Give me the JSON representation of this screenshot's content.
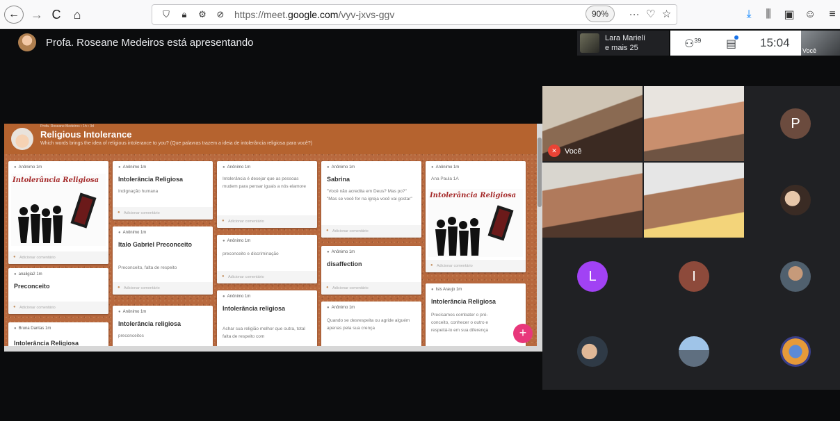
{
  "browser": {
    "back_icon": "←",
    "forward_icon": "→",
    "reload_icon": "C",
    "home_icon": "⌂",
    "url_prefix": "https://meet.",
    "url_host": "google.com",
    "url_path": "/vyv-jxvs-ggv",
    "zoom": "90%",
    "more_icon": "···"
  },
  "meet": {
    "presenting_text": "Profa. Roseane Medeiros está apresentando",
    "pinned_name": "Lara Marielí",
    "pinned_more": "e mais 25",
    "participant_count": "39",
    "clock": "15:04",
    "self_label": "Você"
  },
  "padlet": {
    "byline": "Profa. Roseane Medeiros • 1h • 3d",
    "title": "Religious Intolerance",
    "subtitle": "Which words brings the idea of religious intolerance to you? (Que palavras trazem a ideia de intolerância religiosa para você?)",
    "add_comment": "Adicionar comentário",
    "image_caption": "Intolerância Religiosa",
    "cards": [
      {
        "author": "Anônimo 1m",
        "title": "",
        "body": ""
      },
      {
        "author": "analigia2 1m",
        "title": "Preconceito",
        "body": ""
      },
      {
        "author": "Bruna Dantas 1m",
        "title": "Intolerância Religiosa",
        "body": ""
      },
      {
        "author": "Anônimo 1m",
        "title": "Intolerância Religiosa",
        "body": "Indignação humana"
      },
      {
        "author": "Anônimo 1m",
        "title": "Italo Gabriel Preconceito",
        "body": "Preconceito, falta de respeito"
      },
      {
        "author": "Anônimo 1m",
        "title": "Intolerância religiosa",
        "body": "preconceitos"
      },
      {
        "author": "Anônimo 1m",
        "title": "",
        "body": "Intolerância é desejar que as pessoas mudem para pensar iguais a nós elamore"
      },
      {
        "author": "Anônimo 1m",
        "title": "",
        "body": "preconceito e discriminação"
      },
      {
        "author": "Anônimo 1m",
        "title": "Intolerância religiosa",
        "body": "Achar sua religião melhor que outra, total falta de respeito com"
      },
      {
        "author": "Anônimo 1m",
        "title": "Sabrina",
        "body": "\"Você não acredita em Deus? Mas po?\" \"Mas se você for na igreja você vai gostar\""
      },
      {
        "author": "Anônimo 1m",
        "title": "disaffection",
        "body": ""
      },
      {
        "author": "Anônimo 1m",
        "title": "",
        "body": "Quando se desrespeita ou agride alguém apenas pela sua crença"
      },
      {
        "author": "Anônimo 1m",
        "title": "",
        "body": "Ana Paula 1A"
      },
      {
        "author": "Isis Araujo 1m",
        "title": "Intolerância Religiosa",
        "body": "Precisamos combater o pré-conceito, conhecer o outro e respeitá-lo em sua diferença"
      }
    ]
  },
  "participants": {
    "self_name": "Você",
    "letters": [
      "P",
      "L",
      "I"
    ],
    "colors": {
      "p": "#6b4b3e",
      "l": "#a142f4",
      "i": "#8d4a3b"
    }
  }
}
